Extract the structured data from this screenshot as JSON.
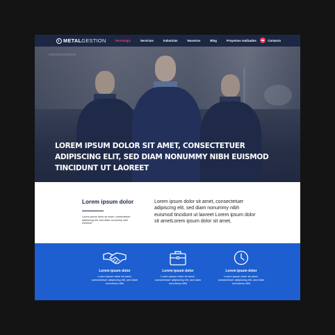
{
  "nav": {
    "logo_bold": "METAL",
    "logo_light": "GESTION",
    "items": [
      {
        "label": "Tecnologia",
        "active": true
      },
      {
        "label": "Servicios",
        "active": false
      },
      {
        "label": "Industrias",
        "active": false
      },
      {
        "label": "Nosotros",
        "active": false
      },
      {
        "label": "Blog",
        "active": false
      },
      {
        "label": "Proyectos realizados",
        "active": false
      }
    ],
    "contact_label": "Contacto"
  },
  "hero": {
    "title": "LOREM IPSUM DOLOR SIT AMET, CONSECTETUER ADIPISCING ELIT, SED DIAM NONUMMY NIBH EUISMOD TINCIDUNT UT LAOREET"
  },
  "about": {
    "heading": "Lorem ipsum dolor",
    "small_text": "Lorem ipsum dolor sit amet, consectetuer adipiscing elit, sed diam nonummy nibh euismod",
    "paragraph": "Lorem ipsum dolor sit amet, consectetuer adipiscing elit, sed diam nonummy nibh euismod tincidunt ut laoreet Lorem ipsum dolor sit ametLorem ipsum dolor sit amet,"
  },
  "features": [
    {
      "icon": "handshake-icon",
      "title": "Lorem ipsum dolor",
      "desc": "Lorem ipsum dolor sit amet, consectetuer adipiscing elit, sed diam nonummy nibh"
    },
    {
      "icon": "briefcase-icon",
      "title": "Lorem ipsum dolor",
      "desc": "Lorem ipsum dolor sit amet, consectetuer adipiscing elit, sed diam nonummy nibh"
    },
    {
      "icon": "clock-icon",
      "title": "Lorem ipsum dolor",
      "desc": "Lorem ipsum dolor sit amet, consectetuer adipiscing elit, sed diam nonummy nibh"
    }
  ],
  "colors": {
    "nav_bg": "#1c2744",
    "accent": "#ff3e63",
    "feature_bg": "#1d5fd0",
    "outer_bg": "#141414"
  }
}
